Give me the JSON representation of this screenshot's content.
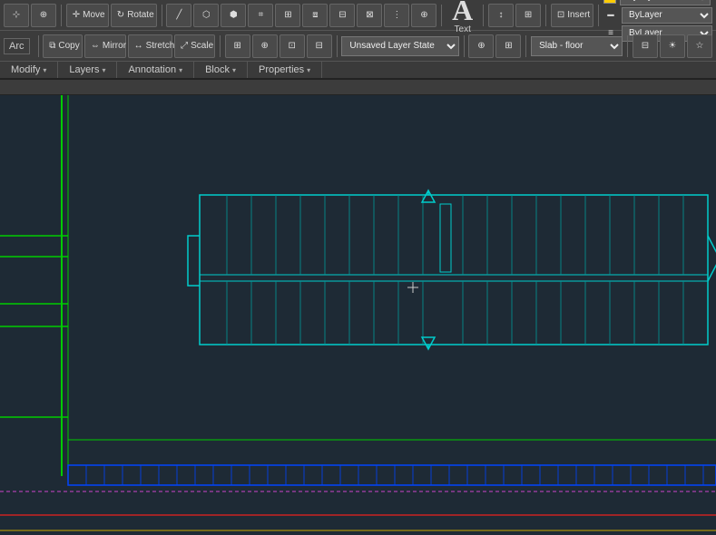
{
  "toolbar": {
    "row1_buttons": [
      {
        "label": "Move",
        "icon": "✛"
      },
      {
        "label": "Rotate",
        "icon": "↻"
      },
      {
        "label": "Copy",
        "icon": "⧉"
      },
      {
        "label": "Mirror",
        "icon": "⇔"
      },
      {
        "label": "Stretch",
        "icon": "↔"
      },
      {
        "label": "Scale",
        "icon": "⤢"
      }
    ],
    "arc_label": "Arc",
    "text_section": {
      "label": "Text",
      "big_icon": "A"
    },
    "insert_label": "Insert",
    "layer_state": "Unsaved Layer State",
    "layer_floor": "Slab - floor",
    "bylayer1": "ByLayer",
    "bylayer2": "ByLayer",
    "bylayer3": "ByLayer"
  },
  "ribbon_tabs": [
    {
      "label": "Modify",
      "has_arrow": true
    },
    {
      "label": "Layers",
      "has_arrow": true
    },
    {
      "label": "Annotation",
      "has_arrow": true
    },
    {
      "label": "Block",
      "has_arrow": true
    },
    {
      "label": "Properties",
      "has_arrow": true
    }
  ],
  "canvas": {
    "background": "#1e2a35"
  },
  "statusbar": {
    "items": []
  }
}
